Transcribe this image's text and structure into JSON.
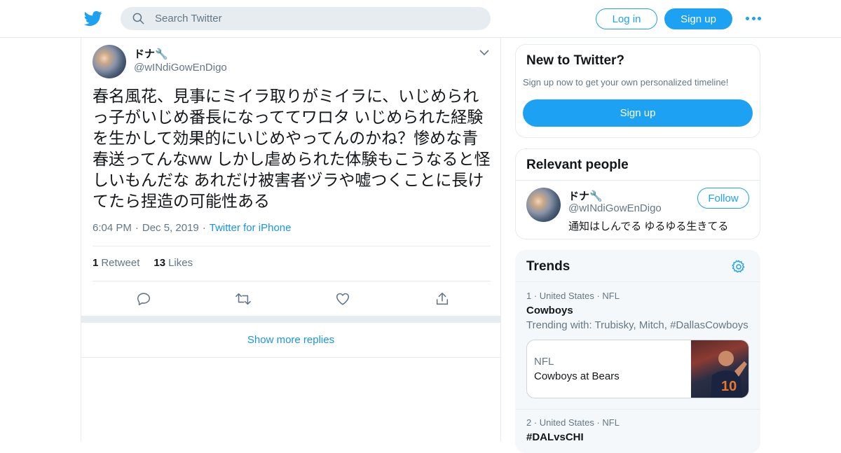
{
  "header": {
    "search_placeholder": "Search Twitter",
    "login_label": "Log in",
    "signup_label": "Sign up",
    "brand_color": "#1da1f2"
  },
  "tweet": {
    "display_name": "ドナ🔧",
    "handle": "@wINdiGowEnDigo",
    "text": "春名風花、見事にミイラ取りがミイラに、いじめられっ子がいじめ番長になっててワロタ いじめられた経験を生かして効果的にいじめやってんのかね？惨めな青春送ってんなww しかし虐められた体験もこうなると怪しいもんだな あれだけ被害者ヅラや嘘つくことに長けてたら捏造の可能性ある",
    "time": "6:04 PM",
    "date": "Dec 5, 2019",
    "source": "Twitter for iPhone",
    "retweets_count": "1",
    "retweets_label": "Retweet",
    "likes_count": "13",
    "likes_label": "Likes",
    "show_more_label": "Show more replies"
  },
  "sidebar": {
    "new_to_twitter": {
      "title": "New to Twitter?",
      "subtitle": "Sign up now to get your own personalized timeline!",
      "signup_label": "Sign up"
    },
    "relevant_people": {
      "title": "Relevant people",
      "person": {
        "display_name": "ドナ🔧",
        "handle": "@wINdiGowEnDigo",
        "bio": "通知はしんでる ゆるゆる生きてる",
        "follow_label": "Follow"
      }
    },
    "trends": {
      "title": "Trends",
      "items": [
        {
          "meta": "1 · United States · NFL",
          "name": "Cowboys",
          "trending_with": "Trending with: Trubisky, Mitch, #DallasCowboys",
          "news_category": "NFL",
          "news_title": "Cowboys at Bears"
        },
        {
          "meta": "2 · United States · NFL",
          "name": "#DALvsCHI"
        }
      ]
    }
  }
}
